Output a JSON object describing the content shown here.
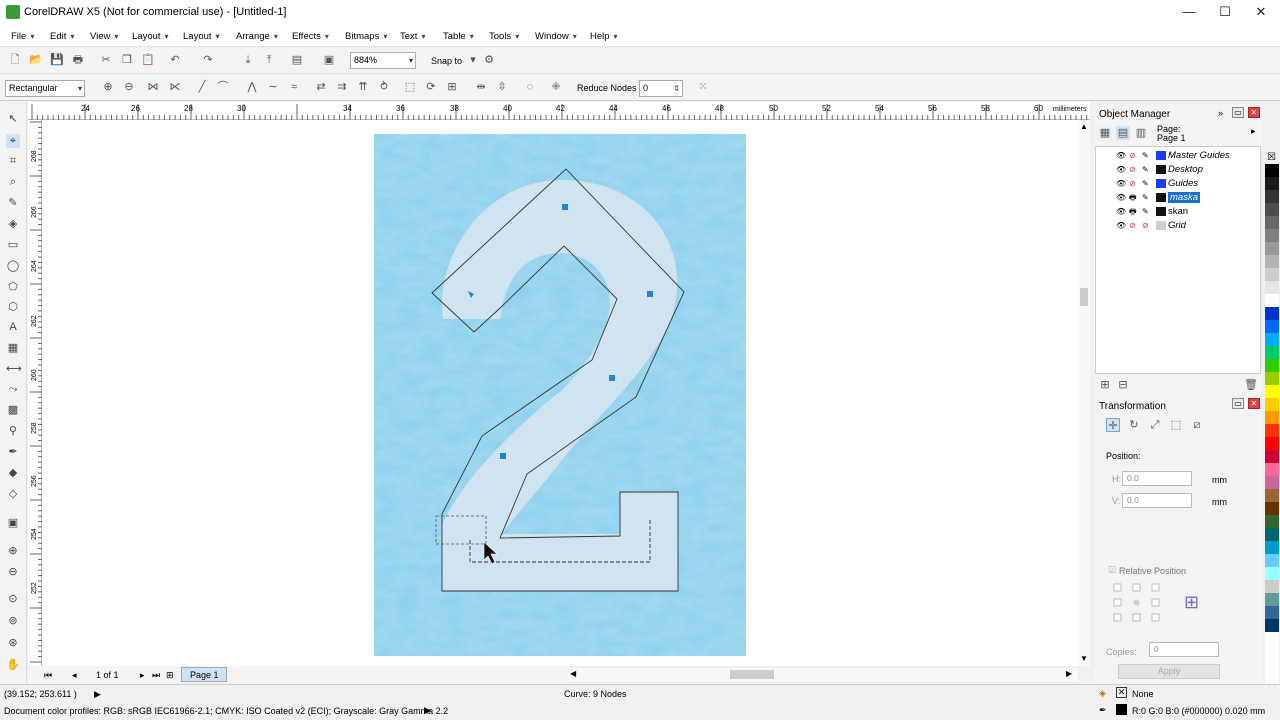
{
  "window": {
    "title": "CorelDRAW X5 (Not for commercial use) - [Untitled-1]",
    "minimize": "—",
    "maximize": "☐",
    "close": "✕"
  },
  "menu": [
    "File",
    "Edit",
    "View",
    "Layout",
    "Layout",
    "Arrange",
    "Effects",
    "Bitmaps",
    "Text",
    "Table",
    "Tools",
    "Window",
    "Help"
  ],
  "toolbar": {
    "zoom_value": "884%",
    "snap_to": "Snap to"
  },
  "property_bar": {
    "mode": "Rectangular",
    "reduce_nodes_label": "Reduce Nodes",
    "reduce_nodes_value": "0"
  },
  "ruler": {
    "h_labels": [
      "24",
      "26",
      "28",
      "30",
      "34",
      "36",
      "38",
      "40",
      "42",
      "44",
      "46",
      "48",
      "50",
      "52",
      "54",
      "56",
      "58",
      "60"
    ],
    "units": "millimeters",
    "v_labels": [
      "268",
      "266",
      "264",
      "262",
      "260",
      "258",
      "256",
      "254",
      "252"
    ]
  },
  "page_nav": {
    "count": "1 of 1",
    "tab": "Page 1"
  },
  "status": {
    "cursor_coords": "(39.152; 253.611 )",
    "curve_info": "Curve: 9 Nodes",
    "color_profiles": "Document color profiles: RGB: sRGB IEC61966-2.1; CMYK: ISO Coated v2 (ECI); Grayscale: Gray Gamma 2.2",
    "fill_label": "None",
    "outline_info": "R:0 G:0 B:0 (#000000)  0.020 mm"
  },
  "object_manager": {
    "title": "Object Manager",
    "page_label": "Page:",
    "page_name": "Page 1",
    "layers": [
      {
        "name": "Master Guides",
        "color": "#1a3cff"
      },
      {
        "name": "Desktop",
        "color": "#111111"
      },
      {
        "name": "Guides",
        "color": "#1a3cff"
      },
      {
        "name": "maska",
        "color": "#111111",
        "selected": true
      },
      {
        "name": "skan",
        "color": "#111111"
      },
      {
        "name": "Grid",
        "color": "#d0d0d0"
      }
    ]
  },
  "transformation": {
    "title": "Transformation",
    "position_label": "Position:",
    "h_label": "H:",
    "h_value": "0.0",
    "v_label": "V:",
    "v_value": "0.0",
    "unit": "mm",
    "relative_position": "Relative Position",
    "copies_label": "Copies:",
    "copies_value": "0",
    "apply": "Apply"
  },
  "palette": [
    "#000000",
    "#1a1a1a",
    "#333333",
    "#4d4d4d",
    "#666666",
    "#808080",
    "#999999",
    "#b3b3b3",
    "#cccccc",
    "#e6e6e6",
    "#ffffff",
    "#0033cc",
    "#0066ff",
    "#00aaff",
    "#00cc66",
    "#33cc00",
    "#99cc00",
    "#ffff00",
    "#ffcc00",
    "#ff9900",
    "#ff3300",
    "#ff0000",
    "#cc0033",
    "#ff6699",
    "#cc6699",
    "#996633",
    "#663300",
    "#336633",
    "#006666",
    "#0099cc",
    "#66ccff",
    "#99ffff",
    "#cccccc",
    "#669999",
    "#336699",
    "#003366"
  ]
}
